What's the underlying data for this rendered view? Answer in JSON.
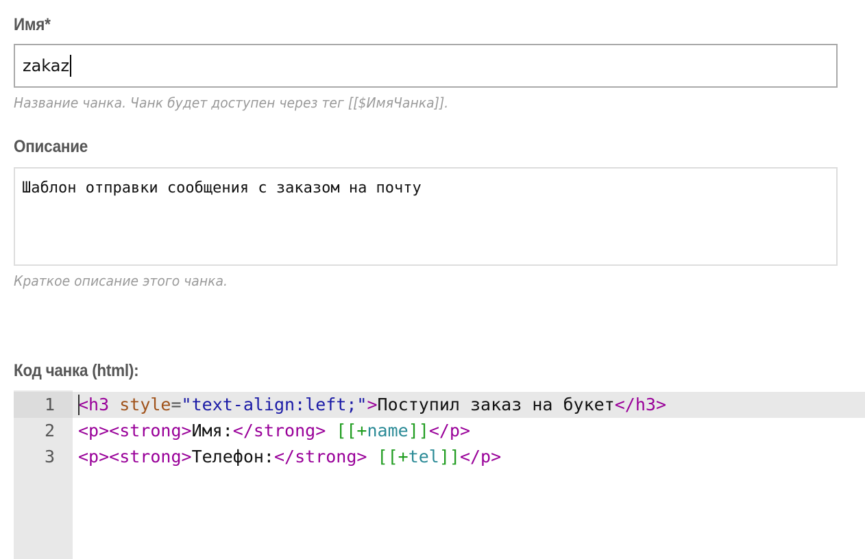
{
  "name_field": {
    "label": "Имя*",
    "value": "zakaz",
    "help": "Название чанка. Чанк будет доступен через тег [[$ИмяЧанка]]."
  },
  "description_field": {
    "label": "Описание",
    "value": "Шаблон отправки сообщения с заказом на почту",
    "help": "Краткое описание этого чанка."
  },
  "code_field": {
    "label": "Код чанка (html):",
    "lines": [
      {
        "number": "1",
        "tokens": [
          {
            "type": "tag",
            "text": "<h3"
          },
          {
            "type": "text",
            "text": " "
          },
          {
            "type": "attr",
            "text": "style"
          },
          {
            "type": "eq",
            "text": "="
          },
          {
            "type": "str",
            "text": "\"text-align:left;\""
          },
          {
            "type": "tag",
            "text": ">"
          },
          {
            "type": "text",
            "text": "Поступил заказ на букет"
          },
          {
            "type": "tag",
            "text": "</h3>"
          }
        ]
      },
      {
        "number": "2",
        "tokens": [
          {
            "type": "tag",
            "text": "<p><strong>"
          },
          {
            "type": "text",
            "text": "Имя:"
          },
          {
            "type": "tag",
            "text": "</strong>"
          },
          {
            "type": "text",
            "text": " "
          },
          {
            "type": "ph",
            "text": "[[+"
          },
          {
            "type": "phname",
            "text": "name"
          },
          {
            "type": "ph",
            "text": "]]"
          },
          {
            "type": "tag",
            "text": "</p>"
          }
        ]
      },
      {
        "number": "3",
        "tokens": [
          {
            "type": "tag",
            "text": "<p><strong>"
          },
          {
            "type": "text",
            "text": "Телефон:"
          },
          {
            "type": "tag",
            "text": "</strong>"
          },
          {
            "type": "text",
            "text": " "
          },
          {
            "type": "ph",
            "text": "[[+"
          },
          {
            "type": "phname",
            "text": "tel"
          },
          {
            "type": "ph",
            "text": "]]"
          },
          {
            "type": "tag",
            "text": "</p>"
          }
        ]
      }
    ]
  }
}
